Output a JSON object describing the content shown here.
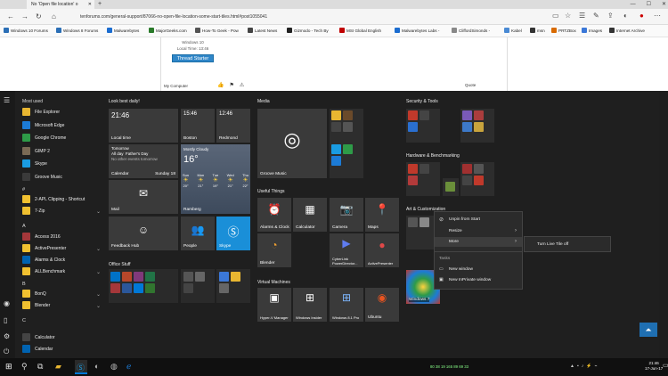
{
  "browser": {
    "tab_title": "No 'Open file location' o",
    "url": "tenforums.com/general-support/87066-no-open-file-location-some-start-tiles.html#post1055041",
    "favorites": [
      {
        "label": "Windows 10 Forums",
        "color": "#2b6fb6"
      },
      {
        "label": "Windows 8 Forums",
        "color": "#2b6fb6"
      },
      {
        "label": "Malwarebytes",
        "color": "#1c6dd0"
      },
      {
        "label": "MajorGeeks.com",
        "color": "#2a7a2a"
      },
      {
        "label": "How-To Geek - Pow",
        "color": "#555555"
      },
      {
        "label": "Latest News",
        "color": "#444444"
      },
      {
        "label": "Gizmodo - Tech By",
        "color": "#222222"
      },
      {
        "label": "MSI Global English",
        "color": "#c00000"
      },
      {
        "label": "Malwarebytes Labs -",
        "color": "#1c6dd0"
      },
      {
        "label": "CliffordSimonds -",
        "color": "#888888"
      },
      {
        "label": "Kabel",
        "color": "#4a8ad4"
      },
      {
        "label": "msn",
        "color": "#333333"
      },
      {
        "label": "PRTZBox",
        "color": "#d86a00"
      },
      {
        "label": "Images",
        "color": "#3b78d8"
      },
      {
        "label": "Internet Archive",
        "color": "#333333"
      }
    ]
  },
  "page": {
    "os_line": "Windows 10",
    "local_time": "Local Time: 13:46",
    "thread_starter": "Thread Starter",
    "my_computer": "My Computer",
    "quote": "Quote"
  },
  "start": {
    "most_used_header": "Most used",
    "most_used": [
      {
        "label": "File Explorer",
        "color": "#e8b631"
      },
      {
        "label": "Microsoft Edge",
        "color": "#1c7bd6"
      },
      {
        "label": "Google Chrome",
        "color": "#2e9b48"
      },
      {
        "label": "GIMP 2",
        "color": "#7a6a55"
      },
      {
        "label": "Skype",
        "color": "#1a9ce2"
      },
      {
        "label": "Groove Music",
        "color": "#3a3a3a"
      }
    ],
    "letters": {
      "hash": "#",
      "a": "A",
      "b": "B",
      "c": "C"
    },
    "all_apps": {
      "apfl": "2-APL Clipping - Shortcut",
      "zip": "7-Zip",
      "access": "Access 2016",
      "activepresenter": "ActivePresenter",
      "alarms": "Alarms & Clock",
      "allbenchmark": "ALLBenchmark",
      "bonq": "BonQ",
      "blender": "Blender",
      "calculator": "Calculator",
      "calendar": "Calendar"
    },
    "groups": {
      "lookbest": "Look best daily!",
      "media": "Media",
      "security": "Security & Tools",
      "useful": "Useful Things",
      "hardware": "Hardware & Benchmarking",
      "art": "Art & Customization",
      "office": "Office Stuff",
      "vm": "Virtual Machines"
    },
    "tiles": {
      "local_time": "Local time",
      "local_time_val": "21:46",
      "boston": "Boston",
      "boston_val": "15:46",
      "redmond": "Redmond",
      "redmond_val": "12:46",
      "calendar": "Calendar",
      "cal_tomorrow": "Tomorrow",
      "cal_allday": "All day",
      "cal_event": "Father's Day",
      "cal_more": "No other events tomorrow",
      "calendar_day": "Sunday 18",
      "weather_cond": "Mostly Cloudy",
      "weather_temp": "16°",
      "weather_place": "Ramberg",
      "weather_days": [
        "Sun",
        "Mon",
        "Tue",
        "Wed",
        "Thu"
      ],
      "weather_temps": [
        "20°",
        "21°",
        "19°",
        "21°",
        "22°"
      ],
      "mail": "Mail",
      "groove": "Groove Music",
      "feedback": "Feedback Hub",
      "people": "People",
      "skype": "Skype",
      "alarms": "Alarms & Clock",
      "calculator": "Calculator",
      "camera": "Camera",
      "maps": "Maps",
      "blender": "Blender",
      "cyberlink": "CyberLink PowerDirector...",
      "activepresenter": "ActivePresenter",
      "hyperv": "Hyper-V Manager",
      "insider": "Windows Insider",
      "win81": "Windows 8.1 Pro",
      "ubuntu": "Ubuntu",
      "windows7": "Windows 7"
    },
    "context": {
      "unpin": "Unpin from Start",
      "resize": "Resize",
      "more": "More",
      "tasks": "Tasks",
      "new_window": "New window",
      "new_inprivate": "New InPrivate window",
      "live_tile_off": "Turn Live Tile off"
    }
  },
  "taskbar": {
    "time": "21:46",
    "date": "17-Jun-17",
    "tray_text": "80  38  19  165  89  69  33"
  },
  "colors": {
    "accent": "#0078d7",
    "tile": "#3a3a3a",
    "start_bg": "#1f1f1f"
  }
}
